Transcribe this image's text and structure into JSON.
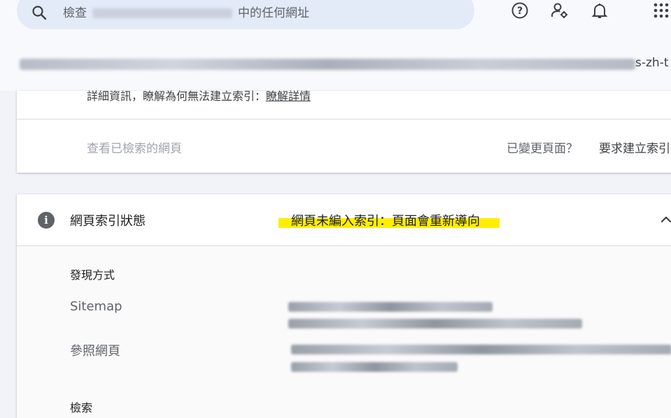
{
  "search": {
    "prefix": "檢查",
    "suffix": "中的任何網址"
  },
  "top_icons": [
    "help-icon",
    "manage-users-icon",
    "notifications-icon",
    "apps-grid-icon"
  ],
  "url_row": {
    "tail": "s-zh-t"
  },
  "card1": {
    "details_text": "詳細資訊，瞭解為何無法建立索引：",
    "details_link": "瞭解詳情",
    "view_crawled": "查看已檢索的網頁",
    "changed_page": "已變更頁面？",
    "request_indexing": "要求建立索引"
  },
  "card2": {
    "title": "網頁索引狀態",
    "status": "網頁未編入索引：頁面會重新導向",
    "discovery_heading": "發現方式",
    "sitemap_label": "Sitemap",
    "referring_label": "參照網頁",
    "crawl_heading": "檢索"
  },
  "colors": {
    "highlight": "#ffee00",
    "search_bg": "#e3eaf8",
    "page_bg": "#f1f3f9"
  }
}
